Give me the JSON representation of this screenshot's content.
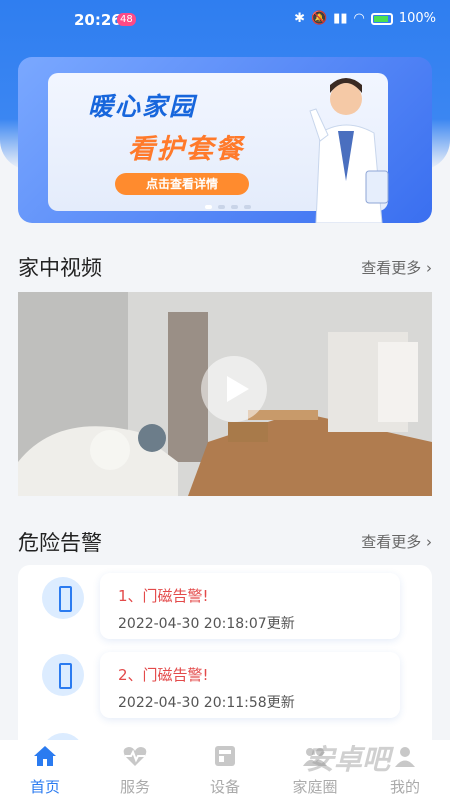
{
  "status": {
    "time": "20:26",
    "badge": "48",
    "battery": "100%"
  },
  "banner": {
    "title1": "暖心家园",
    "title2": "看护套餐",
    "button": "点击查看详情"
  },
  "video_section": {
    "title": "家中视频",
    "more": "查看更多"
  },
  "alarm_section": {
    "title": "危险告警",
    "more": "查看更多",
    "items": [
      {
        "title": "1、门磁告警!",
        "time": "2022-04-30 20:18:07更新"
      },
      {
        "title": "2、门磁告警!",
        "time": "2022-04-30 20:11:58更新"
      }
    ]
  },
  "tabs": [
    {
      "label": "首页"
    },
    {
      "label": "服务"
    },
    {
      "label": "设备"
    },
    {
      "label": "家庭圈"
    },
    {
      "label": "我的"
    }
  ],
  "watermark": "安卓吧",
  "colors": {
    "primary": "#2b7bf0",
    "alert": "#e34a4a",
    "accent": "#ff8b2e"
  }
}
